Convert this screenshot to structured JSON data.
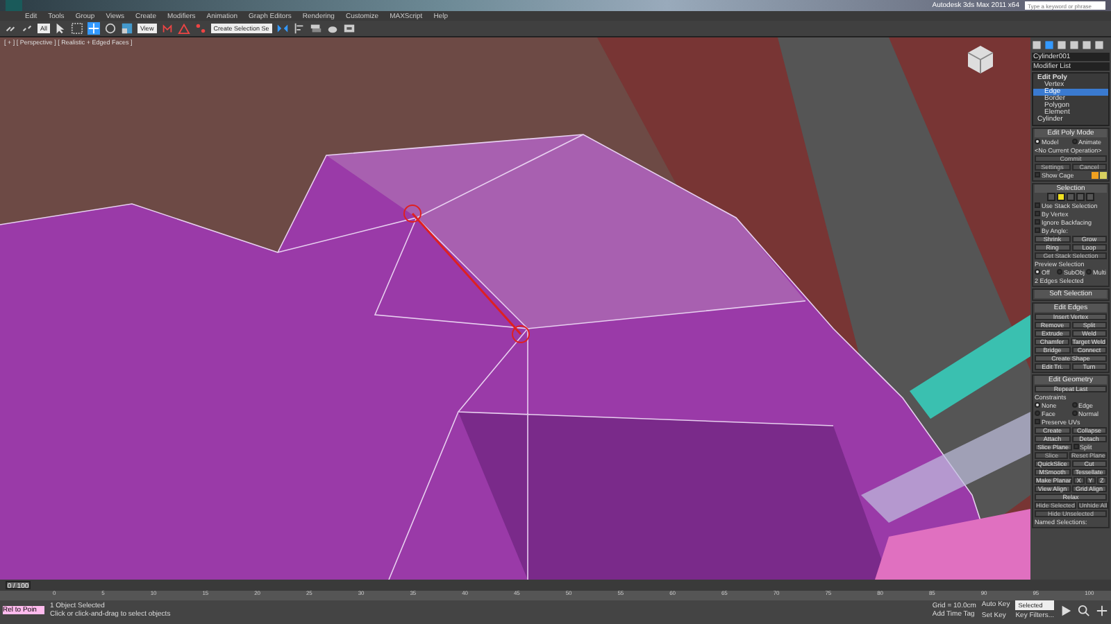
{
  "window": {
    "title": "Autodesk 3ds Max 2011 x64"
  },
  "search": {
    "placeholder": "Type a keyword or phrase"
  },
  "menu": [
    "Edit",
    "Tools",
    "Group",
    "Views",
    "Create",
    "Modifiers",
    "Animation",
    "Graph Editors",
    "Rendering",
    "Customize",
    "MAXScript",
    "Help"
  ],
  "toolbar": {
    "filter": "All",
    "coordinate_system": "View",
    "selection_set": "Create Selection Se"
  },
  "viewport": {
    "label": "[ + ] [ Perspective ] [ Realistic + Edged Faces ]"
  },
  "command_panel": {
    "object_name": "Cylinder001",
    "modifier_list": "Modifier List",
    "stack": [
      {
        "label": "Edit Poly",
        "expanded": true,
        "children": [
          {
            "label": "Vertex",
            "selected": false
          },
          {
            "label": "Edge",
            "selected": true
          },
          {
            "label": "Border",
            "selected": false
          },
          {
            "label": "Polygon",
            "selected": false
          },
          {
            "label": "Element",
            "selected": false
          }
        ]
      },
      {
        "label": "Cylinder",
        "expanded": false
      }
    ],
    "rollouts": [
      {
        "title": "Edit Poly Mode",
        "rows": [
          [
            {
              "kind": "radio",
              "label": "Model",
              "selected": true
            },
            {
              "kind": "radio",
              "label": "Animate",
              "selected": false
            }
          ],
          [
            {
              "kind": "label",
              "label": "<No Current Operation>"
            }
          ],
          [
            {
              "kind": "button",
              "label": "Commit",
              "disabled": true
            }
          ],
          [
            {
              "kind": "button",
              "label": "Settings",
              "disabled": true
            },
            {
              "kind": "button",
              "label": "Cancel",
              "disabled": true
            }
          ],
          [
            {
              "kind": "check",
              "label": "Show Cage",
              "checked": false
            },
            {
              "kind": "swatch",
              "color": "#f0a020"
            },
            {
              "kind": "swatch",
              "color": "#d8d060"
            }
          ]
        ]
      },
      {
        "title": "Selection",
        "rows": [
          [
            {
              "kind": "subobj",
              "selected": false
            },
            {
              "kind": "subobj",
              "selected": true
            },
            {
              "kind": "subobj",
              "selected": false
            },
            {
              "kind": "subobj",
              "selected": false
            },
            {
              "kind": "subobj",
              "selected": false
            }
          ],
          [
            {
              "kind": "check",
              "label": "Use Stack Selection",
              "checked": false
            }
          ],
          [
            {
              "kind": "check",
              "label": "By Vertex",
              "checked": false
            }
          ],
          [
            {
              "kind": "check",
              "label": "Ignore Backfacing",
              "checked": false
            }
          ],
          [
            {
              "kind": "check",
              "label": "By Angle:",
              "checked": false
            }
          ],
          [
            {
              "kind": "button",
              "label": "Shrink",
              "disabled": false
            },
            {
              "kind": "button",
              "label": "Grow",
              "disabled": false
            }
          ],
          [
            {
              "kind": "button",
              "label": "Ring",
              "disabled": false
            },
            {
              "kind": "button",
              "label": "Loop",
              "disabled": false
            }
          ],
          [
            {
              "kind": "button",
              "label": "Get Stack Selection",
              "disabled": true
            }
          ],
          [
            {
              "kind": "label",
              "label": "Preview Selection"
            }
          ],
          [
            {
              "kind": "radio",
              "label": "Off",
              "selected": true
            },
            {
              "kind": "radio",
              "label": "SubObj",
              "selected": false
            },
            {
              "kind": "radio",
              "label": "Multi",
              "selected": false
            }
          ],
          [
            {
              "kind": "label",
              "label": "2 Edges Selected"
            }
          ]
        ]
      },
      {
        "title": "Soft Selection"
      },
      {
        "title": "Edit Edges",
        "rows": [
          [
            {
              "kind": "button",
              "label": "Insert Vertex",
              "disabled": false
            }
          ],
          [
            {
              "kind": "button",
              "label": "Remove",
              "disabled": false
            },
            {
              "kind": "button",
              "label": "Split",
              "disabled": false
            }
          ],
          [
            {
              "kind": "button",
              "label": "Extrude",
              "disabled": false
            },
            {
              "kind": "button",
              "label": "Weld",
              "disabled": false
            }
          ],
          [
            {
              "kind": "button",
              "label": "Chamfer",
              "disabled": false
            },
            {
              "kind": "button",
              "label": "Target Weld",
              "disabled": false
            }
          ],
          [
            {
              "kind": "button",
              "label": "Bridge",
              "disabled": false
            },
            {
              "kind": "button",
              "label": "Connect",
              "disabled": false
            }
          ],
          [
            {
              "kind": "button",
              "label": "Create Shape",
              "disabled": false
            }
          ],
          [
            {
              "kind": "button",
              "label": "Edit Tri.",
              "disabled": false
            },
            {
              "kind": "button",
              "label": "Turn",
              "disabled": false
            }
          ]
        ]
      },
      {
        "title": "Edit Geometry",
        "rows": [
          [
            {
              "kind": "button",
              "label": "Repeat Last",
              "disabled": false
            }
          ],
          [
            {
              "kind": "label",
              "label": "Constraints"
            }
          ],
          [
            {
              "kind": "radio",
              "label": "None",
              "selected": true
            },
            {
              "kind": "radio",
              "label": "Edge",
              "selected": false
            }
          ],
          [
            {
              "kind": "radio",
              "label": "Face",
              "selected": false
            },
            {
              "kind": "radio",
              "label": "Normal",
              "selected": false
            }
          ],
          [
            {
              "kind": "check",
              "label": "Preserve UVs",
              "checked": false
            }
          ],
          [
            {
              "kind": "button",
              "label": "Create",
              "disabled": false
            },
            {
              "kind": "button",
              "label": "Collapse",
              "disabled": false
            }
          ],
          [
            {
              "kind": "button",
              "label": "Attach",
              "disabled": false
            },
            {
              "kind": "button",
              "label": "Detach",
              "disabled": false
            }
          ],
          [
            {
              "kind": "button",
              "label": "Slice Plane",
              "disabled": false
            },
            {
              "kind": "check",
              "label": "Split",
              "checked": false
            }
          ],
          [
            {
              "kind": "button",
              "label": "Slice",
              "disabled": true
            },
            {
              "kind": "button",
              "label": "Reset Plane",
              "disabled": true
            }
          ],
          [
            {
              "kind": "button",
              "label": "QuickSlice",
              "disabled": false
            },
            {
              "kind": "button",
              "label": "Cut",
              "disabled": false
            }
          ],
          [
            {
              "kind": "button",
              "label": "MSmooth",
              "disabled": false
            },
            {
              "kind": "button",
              "label": "Tessellate",
              "disabled": false
            }
          ],
          [
            {
              "kind": "button",
              "label": "Make Planar",
              "disabled": false
            },
            {
              "kind": "button",
              "label": "X",
              "disabled": false
            },
            {
              "kind": "button",
              "label": "Y",
              "disabled": false
            },
            {
              "kind": "button",
              "label": "Z",
              "disabled": false
            }
          ],
          [
            {
              "kind": "button",
              "label": "View Align",
              "disabled": false
            },
            {
              "kind": "button",
              "label": "Grid Align",
              "disabled": false
            }
          ],
          [
            {
              "kind": "button",
              "label": "Relax",
              "disabled": false
            }
          ],
          [
            {
              "kind": "button",
              "label": "Hide Selected",
              "disabled": true
            },
            {
              "kind": "button",
              "label": "Unhide All",
              "disabled": true
            }
          ],
          [
            {
              "kind": "button",
              "label": "Hide Unselected",
              "disabled": true
            }
          ],
          [
            {
              "kind": "label",
              "label": "Named Selections:"
            }
          ]
        ]
      }
    ]
  },
  "timeline": {
    "frame": "0 / 100",
    "level": 0,
    "ticks": [
      "0",
      "5",
      "10",
      "15",
      "20",
      "25",
      "30",
      "35",
      "40",
      "45",
      "50",
      "55",
      "60",
      "65",
      "70",
      "75",
      "80",
      "85",
      "90",
      "95",
      "100"
    ]
  },
  "status_bar": {
    "script_field": "Rel to Poin",
    "selection": "1 Object Selected",
    "prompt": "Click or click-and-drag to select objects",
    "grid": "Grid = 10.0cm",
    "add_time_tag": "Add Time Tag",
    "auto_key": "Auto Key",
    "set_key": "Set Key",
    "key_mode": "Selected",
    "key_filters": "Key Filters..."
  }
}
